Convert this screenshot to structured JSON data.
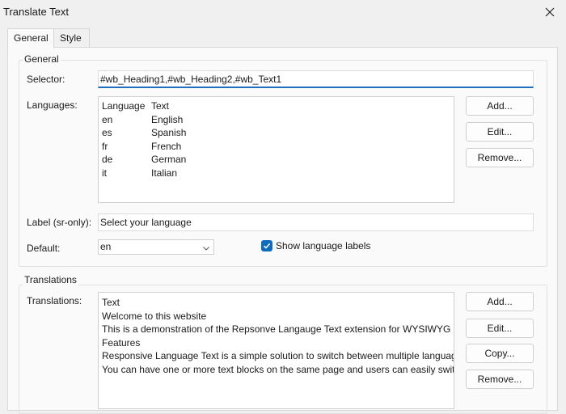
{
  "window": {
    "title": "Translate Text"
  },
  "tabs": [
    {
      "label": "General"
    },
    {
      "label": "Style"
    }
  ],
  "general": {
    "group_title": "General",
    "selector_label": "Selector:",
    "selector_value": "#wb_Heading1,#wb_Heading2,#wb_Text1",
    "languages_label": "Languages:",
    "languages_header": {
      "code": "Language",
      "text": "Text"
    },
    "languages": [
      {
        "code": "en",
        "text": "English"
      },
      {
        "code": "es",
        "text": "Spanish"
      },
      {
        "code": "fr",
        "text": "French"
      },
      {
        "code": "de",
        "text": "German"
      },
      {
        "code": "it",
        "text": "Italian"
      }
    ],
    "lang_buttons": {
      "add": "Add...",
      "edit": "Edit...",
      "remove": "Remove..."
    },
    "label_sr_label": "Label (sr-only):",
    "label_sr_value": "Select your language",
    "default_label": "Default:",
    "default_value": "en",
    "show_labels_text": "Show language labels",
    "show_labels_checked": true
  },
  "translations": {
    "group_title": "Translations",
    "label": "Translations:",
    "rows": [
      "Text",
      "Welcome to this website",
      "This is a demonstration of the Repsonve Langauge Text extension for WYSIWYG",
      "Features",
      "Responsive Language Text is a simple solution to switch between multiple languages",
      "You can have one or more text blocks on the same page and users can easily switch"
    ],
    "buttons": {
      "add": "Add...",
      "edit": "Edit...",
      "copy": "Copy...",
      "remove": "Remove..."
    }
  },
  "colors": {
    "accent": "#0f6cbd"
  }
}
